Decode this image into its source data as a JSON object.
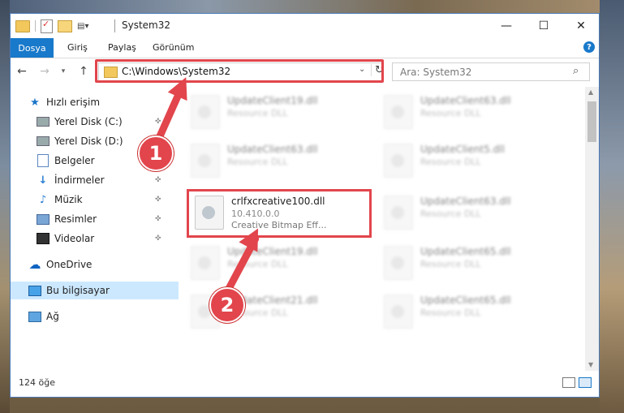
{
  "window": {
    "title": "System32",
    "controls": {
      "minimize": "—",
      "maximize": "☐",
      "close": "✕"
    }
  },
  "ribbon": {
    "tabs": [
      "Dosya",
      "Giriş",
      "Paylaş",
      "Görünüm"
    ],
    "help": "?"
  },
  "address_bar": {
    "path": "C:\\Windows\\System32",
    "search_placeholder": "Ara: System32"
  },
  "navigation": {
    "items": [
      {
        "label": "Hızlı erişim",
        "icon": "star-icon"
      },
      {
        "label": "Yerel Disk (C:)",
        "icon": "disk-icon",
        "pinned": true
      },
      {
        "label": "Yerel Disk (D:)",
        "icon": "disk-icon",
        "pinned": true
      },
      {
        "label": "Belgeler",
        "icon": "documents-icon",
        "pinned": true
      },
      {
        "label": "İndirmeler",
        "icon": "downloads-icon",
        "pinned": true
      },
      {
        "label": "Müzik",
        "icon": "music-icon",
        "pinned": true
      },
      {
        "label": "Resimler",
        "icon": "pictures-icon",
        "pinned": true
      },
      {
        "label": "Videolar",
        "icon": "videos-icon",
        "pinned": true
      },
      {
        "label": "OneDrive",
        "icon": "cloud-icon"
      },
      {
        "label": "Bu bilgisayar",
        "icon": "computer-icon",
        "selected": true
      },
      {
        "label": "Ağ",
        "icon": "network-icon"
      }
    ]
  },
  "files": {
    "col1": [
      {
        "name": "UpdateClient19.dll",
        "type": "Resource DLL"
      },
      {
        "name": "UpdateClient63.dll",
        "type": "Resource DLL"
      },
      {
        "name": "crlfxcreative100.dll",
        "version": "10.410.0.0",
        "description": "Creative Bitmap Eff..."
      },
      {
        "name": "UpdateClient19.dll",
        "type": "Resource DLL"
      },
      {
        "name": "UpdateClient21.dll",
        "type": "Resource DLL"
      }
    ],
    "col2": [
      {
        "name": "UpdateClient63.dll",
        "type": "Resource DLL"
      },
      {
        "name": "UpdateClient5.dll",
        "type": "Resource DLL"
      },
      {
        "name": "UpdateClient63.dll",
        "type": "Resource DLL"
      },
      {
        "name": "UpdateClient65.dll",
        "type": "Resource DLL"
      },
      {
        "name": "UpdateClient65.dll",
        "type": "Resource DLL"
      }
    ]
  },
  "status": {
    "count": "124 öğe"
  },
  "annotations": {
    "step1": "1",
    "step2": "2"
  },
  "colors": {
    "accent": "#1979ca",
    "highlight": "#e2454c"
  }
}
